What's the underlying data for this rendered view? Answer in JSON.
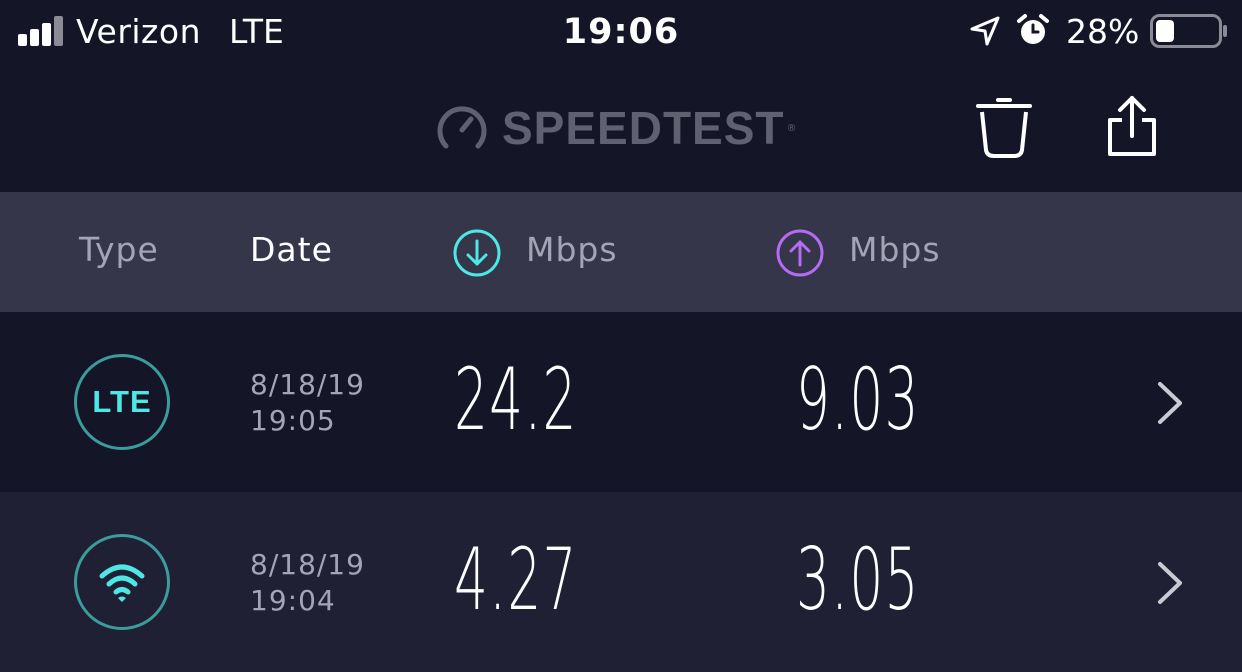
{
  "status_bar": {
    "carrier": "Verizon",
    "network": "LTE",
    "time": "19:06",
    "battery_percent": "28%",
    "battery_level": 0.28
  },
  "toolbar": {
    "logo_text": "SPEEDTEST",
    "logo_reg": "®",
    "icons": [
      "gauge-logo-icon",
      "trash-icon",
      "share-icon"
    ]
  },
  "table_header": {
    "type_label": "Type",
    "date_label": "Date",
    "download_label": "Mbps",
    "upload_label": "Mbps",
    "download_icon": "arrow-down-circle-icon",
    "upload_icon": "arrow-up-circle-icon"
  },
  "results": [
    {
      "type": "LTE",
      "type_icon": "lte-badge",
      "date": "8/18/19",
      "time": "19:05",
      "download": "24.2",
      "upload": "9.03"
    },
    {
      "type": "",
      "type_icon": "wifi-icon",
      "date": "8/18/19",
      "time": "19:04",
      "download": "4.27",
      "upload": "3.05"
    }
  ],
  "colors": {
    "background": "#141526",
    "header_bg": "#353649",
    "row_alt_bg": "#1f2033",
    "download_accent": "#4ee7e6",
    "upload_accent": "#b46cf5",
    "muted_text": "#a3a4b4",
    "logo_gray": "#5f6070"
  }
}
